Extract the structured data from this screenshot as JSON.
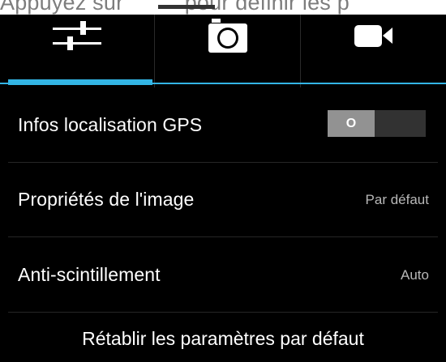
{
  "hint": {
    "text_before": "Appuyez sur",
    "text_after": "pour définir les p"
  },
  "tabs": [
    {
      "name": "settings",
      "icon": "sliders-icon",
      "selected": true
    },
    {
      "name": "photo",
      "icon": "camera-icon",
      "selected": false
    },
    {
      "name": "video",
      "icon": "video-camera-icon",
      "selected": false
    }
  ],
  "settings": {
    "gps": {
      "label": "Infos localisation GPS",
      "toggle_text": "O",
      "enabled": false
    },
    "image": {
      "label": "Propriétés de l'image",
      "value": "Par défaut"
    },
    "flicker": {
      "label": "Anti-scintillement",
      "value": "Auto"
    }
  },
  "reset_label": "Rétablir les paramètres par défaut",
  "colors": {
    "accent": "#33b5e5",
    "background": "#000000"
  }
}
